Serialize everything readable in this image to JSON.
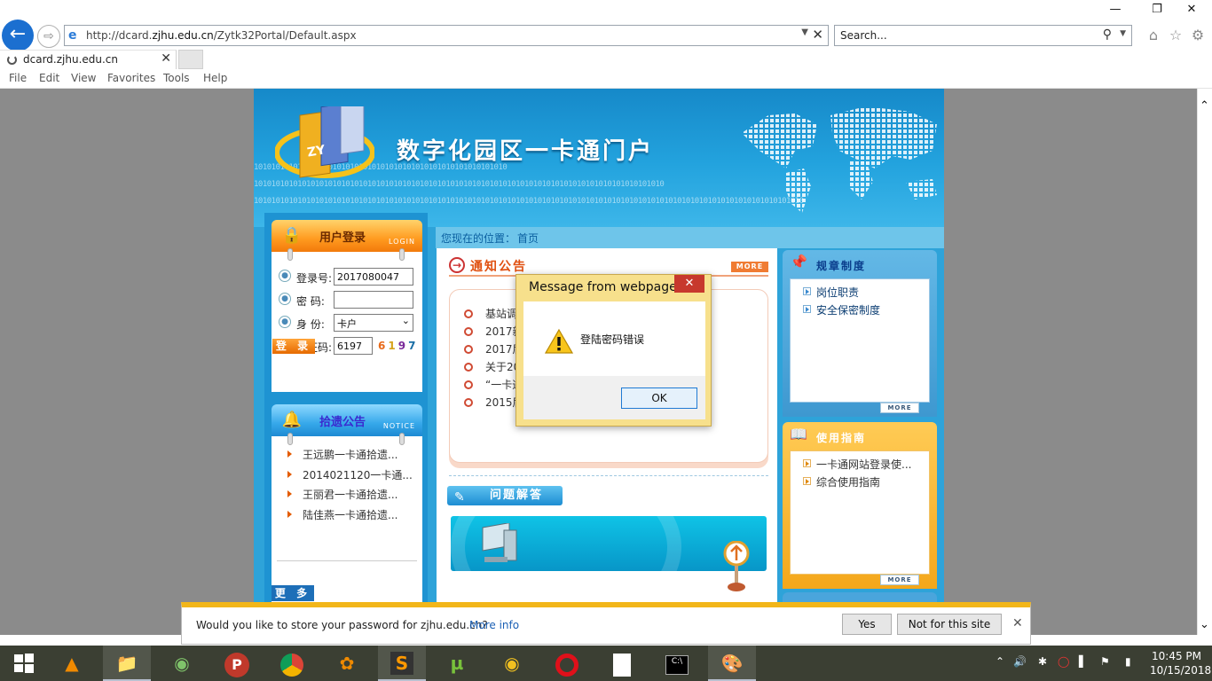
{
  "browser": {
    "window_controls": {
      "minimize": "—",
      "maximize": "❐",
      "close": "✕"
    },
    "url_prefix": "http://dcard.",
    "url_domain": "zjhu.edu.cn",
    "url_path": "/Zytk32Portal/Default.aspx",
    "search_placeholder": "Search...",
    "tab_title": "dcard.zjhu.edu.cn",
    "menu": [
      "File",
      "Edit",
      "View",
      "Favorites",
      "Tools",
      "Help"
    ]
  },
  "site": {
    "title": "数字化园区一卡通门户",
    "location_label": "您现在的位置：",
    "location_value": "首页",
    "login": {
      "title": "用户登录",
      "title_en": "LOGIN",
      "account_label": "登录号:",
      "account_value": "2017080047",
      "password_label": "密  码:",
      "identity_label": "身  份:",
      "identity_value": "卡户",
      "captcha_label": "验证码:",
      "captcha_value": "6197",
      "captcha_digits": [
        {
          "d": "6",
          "color": "#e86a1a"
        },
        {
          "d": "1",
          "color": "#d6a21c"
        },
        {
          "d": "9",
          "color": "#7a2a9a"
        },
        {
          "d": "7",
          "color": "#1c6fa6"
        }
      ],
      "submit_label": "登 录"
    },
    "lost_found": {
      "title": "拾遗公告",
      "title_en": "NOTICE",
      "items": [
        "王远鹏一卡通拾遗...",
        "2014021120一卡通...",
        "王丽君一卡通拾遗...",
        "陆佳燕一卡通拾遗..."
      ],
      "more_label": "更 多"
    },
    "announcements": {
      "title": "通知公告",
      "more_tag": "MORE",
      "items": [
        "基站调",
        "2017新",
        "2017届",
        "关于20",
        "“一卡通",
        "2015届"
      ]
    },
    "faq": {
      "title": "问题解答"
    },
    "rules": {
      "title": "规章制度",
      "items": [
        "岗位职责",
        "安全保密制度"
      ],
      "more_tag": "MORE"
    },
    "guide": {
      "title": "使用指南",
      "items": [
        "一卡通网站登录使...",
        "综合使用指南"
      ],
      "more_tag": "MORE"
    }
  },
  "dialog": {
    "title": "Message from webpage",
    "message": "登陆密码错误",
    "ok_label": "OK",
    "close_glyph": "✕"
  },
  "notification": {
    "text": "Would you like to store your password for zjhu.edu.cn?",
    "more_info": "More info",
    "yes_label": "Yes",
    "no_label": "Not for this site"
  },
  "taskbar": {
    "time": "10:45 PM",
    "date": "10/15/2018"
  },
  "colors": {
    "ie_accent": "#1b6fd0",
    "portal_blue": "#2ea3d9",
    "portal_orange": "#f27a0b",
    "dialog_frame": "#f7e08c",
    "notify_bar": "#f2b619",
    "taskbar": "#3b3f33"
  }
}
